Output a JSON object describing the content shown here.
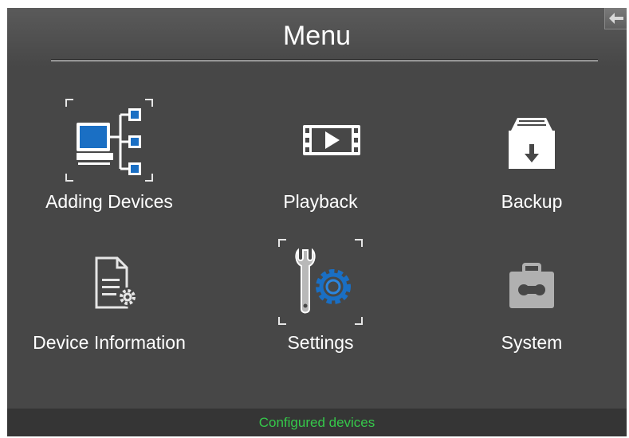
{
  "header": {
    "title": "Menu",
    "back_icon": "back-arrow-icon"
  },
  "menu": {
    "items": [
      {
        "label": "Adding Devices",
        "icon": "network-devices-icon",
        "selected": true
      },
      {
        "label": "Playback",
        "icon": "film-play-icon",
        "selected": false
      },
      {
        "label": "Backup",
        "icon": "archive-download-icon",
        "selected": false
      },
      {
        "label": "Device Information",
        "icon": "document-gear-icon",
        "selected": false
      },
      {
        "label": "Settings",
        "icon": "wrench-gear-icon",
        "selected": true
      },
      {
        "label": "System",
        "icon": "toolbox-icon",
        "selected": false
      }
    ]
  },
  "status": {
    "text": "Configured devices",
    "color": "#35c84a"
  },
  "colors": {
    "background": "#474747",
    "accent": "#1a6fc4",
    "text": "#ffffff"
  }
}
